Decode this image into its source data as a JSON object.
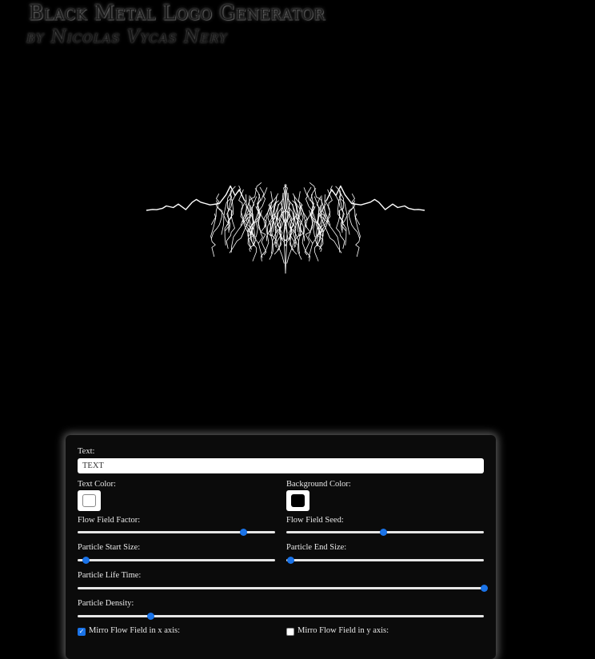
{
  "header": {
    "title": "Black Metal Logo Generator",
    "subtitle": "by Nicolas Vycas Nery"
  },
  "logo": {
    "stroke_color": "#ffffff",
    "background": "#000000"
  },
  "controls": {
    "text": {
      "label": "Text:",
      "value": "TEXT"
    },
    "text_color": {
      "label": "Text Color:",
      "value": "#ffffff"
    },
    "background_color": {
      "label": "Background Color:",
      "value": "#000000"
    },
    "flow_field_factor": {
      "label": "Flow Field Factor:",
      "fraction": 0.84
    },
    "flow_field_seed": {
      "label": "Flow Field Seed:",
      "fraction": 0.49
    },
    "particle_start_size": {
      "label": "Particle Start Size:",
      "fraction": 0.04
    },
    "particle_end_size": {
      "label": "Particle End Size:",
      "fraction": 0.02
    },
    "particle_life_time": {
      "label": "Particle Life Time:",
      "fraction": 1.0
    },
    "particle_density": {
      "label": "Particle Density:",
      "fraction": 0.18
    },
    "mirror_x": {
      "label": "Mirro Flow Field in x axis:",
      "checked": true
    },
    "mirror_y": {
      "label": "Mirro Flow Field in y axis:",
      "checked": false
    }
  },
  "colors": {
    "accent": "#1a73e8",
    "track": "#e6e6e6"
  }
}
